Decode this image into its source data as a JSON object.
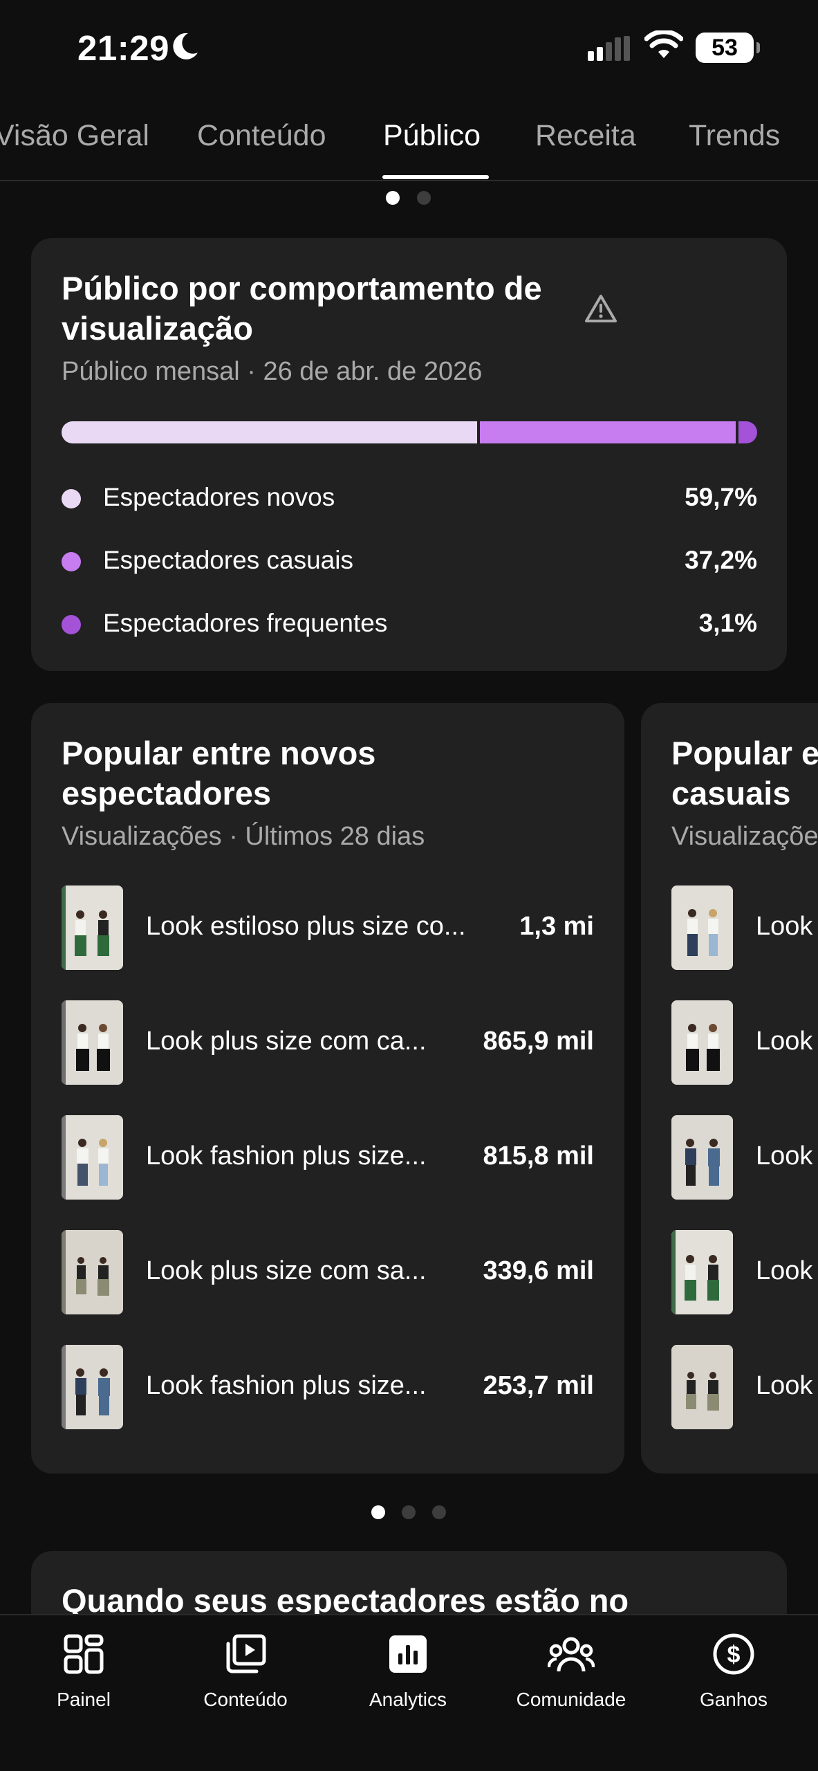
{
  "status_bar": {
    "time": "21:29",
    "battery": "53"
  },
  "tabs": [
    {
      "label": "Visão Geral",
      "active": false
    },
    {
      "label": "Conteúdo",
      "active": false
    },
    {
      "label": "Público",
      "active": true
    },
    {
      "label": "Receita",
      "active": false
    },
    {
      "label": "Trends",
      "active": false
    }
  ],
  "audience_card": {
    "title": "Público por comportamento de visualização",
    "subtitle": "Público mensal · 26 de abr. de 2026",
    "segments": [
      {
        "label": "Espectadores novos",
        "value": "59,7%",
        "share": 0.597,
        "color": "#ead9f5"
      },
      {
        "label": "Espectadores casuais",
        "value": "37,2%",
        "share": 0.372,
        "color": "#c77cf0"
      },
      {
        "label": "Espectadores frequentes",
        "value": "3,1%",
        "share": 0.031,
        "color": "#a452d8"
      }
    ]
  },
  "popular_new": {
    "title": "Popular entre novos\nespectadores",
    "subtitle": "Visualizações · Últimos 28 dias",
    "items": [
      {
        "title": "Look estiloso plus size co...",
        "value": "1,3 mi"
      },
      {
        "title": "Look plus size com ca...",
        "value": "865,9 mil"
      },
      {
        "title": "Look fashion plus size...",
        "value": "815,8 mil"
      },
      {
        "title": "Look plus size com sa...",
        "value": "339,6 mil"
      },
      {
        "title": "Look fashion plus size...",
        "value": "253,7 mil"
      }
    ]
  },
  "popular_casual": {
    "title": "Popular e\ncasuais",
    "subtitle": "Visualizaçõe",
    "items": [
      {
        "title": "Look"
      },
      {
        "title": "Look"
      },
      {
        "title": "Look"
      },
      {
        "title": "Look"
      },
      {
        "title": "Look"
      }
    ]
  },
  "when_card": {
    "title": "Quando seus espectadores estão no"
  },
  "bottom_nav": [
    {
      "label": "Painel",
      "icon": "dashboard-icon"
    },
    {
      "label": "Conteúdo",
      "icon": "content-icon"
    },
    {
      "label": "Analytics",
      "icon": "analytics-icon",
      "active": true
    },
    {
      "label": "Comunidade",
      "icon": "community-icon"
    },
    {
      "label": "Ganhos",
      "icon": "earnings-icon"
    }
  ]
}
